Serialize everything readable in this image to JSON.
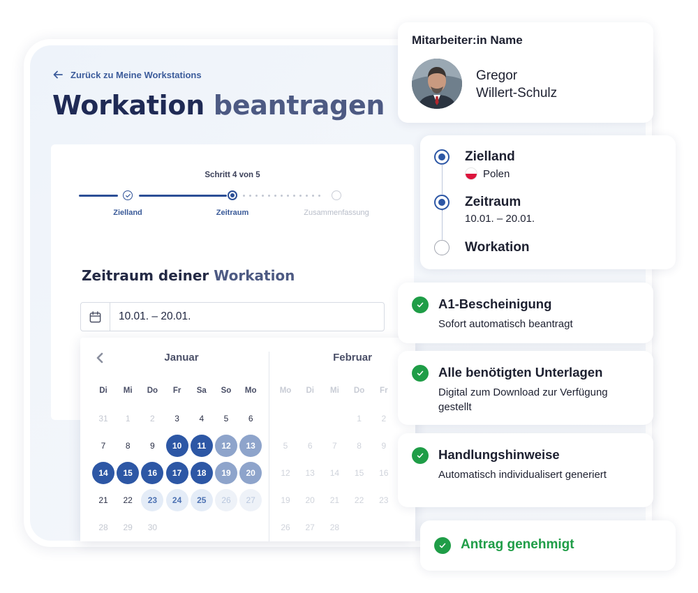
{
  "page": {
    "back_link": "Zurück zu Meine Workstations",
    "title_part1": "Workation",
    "title_part2": "beantragen"
  },
  "wizard": {
    "step_count": "Schritt 4 von 5",
    "steps": [
      {
        "label": "Zielland",
        "state": "done"
      },
      {
        "label": "Zeitraum",
        "state": "active"
      },
      {
        "label": "Zusammenfassung",
        "state": "pending"
      }
    ],
    "section_title_part1": "Zeitraum deiner",
    "section_title_part2": "Workation",
    "date_value": "10.01. – 20.01."
  },
  "calendar": {
    "months": [
      {
        "name": "Januar",
        "weekdays": [
          "Di",
          "Mi",
          "Do",
          "Fr",
          "Sa",
          "So",
          "Mo"
        ],
        "rows": [
          [
            "31",
            "1",
            "2",
            "3",
            "4",
            "5",
            "6"
          ],
          [
            "7",
            "8",
            "9",
            "10",
            "11",
            "12",
            "13"
          ],
          [
            "14",
            "15",
            "16",
            "17",
            "18",
            "19",
            "20"
          ],
          [
            "21",
            "22",
            "23",
            "24",
            "25",
            "26",
            "27"
          ],
          [
            "28",
            "29",
            "30",
            "",
            "",
            "",
            ""
          ]
        ]
      },
      {
        "name": "Februar",
        "weekdays": [
          "Mo",
          "Di",
          "Mi",
          "Do",
          "Fr"
        ],
        "rows": [
          [
            "",
            "",
            "",
            "1",
            "2"
          ],
          [
            "5",
            "6",
            "7",
            "8",
            "9"
          ],
          [
            "12",
            "13",
            "14",
            "15",
            "16"
          ],
          [
            "19",
            "20",
            "21",
            "22",
            "23"
          ],
          [
            "26",
            "27",
            "28",
            "",
            ""
          ]
        ]
      }
    ],
    "colors": {
      "selected": "#2d57a5",
      "selected_weekend": "#8ea4cb",
      "hover": "#e4ecf7"
    }
  },
  "employee": {
    "label": "Mitarbeiter:in Name",
    "first_name": "Gregor",
    "last_name": "Willert-Schulz"
  },
  "timeline": {
    "items": [
      {
        "title": "Zielland",
        "sub": "Polen",
        "state": "active"
      },
      {
        "title": "Zeitraum",
        "sub": "10.01. – 20.01.",
        "state": "active"
      },
      {
        "title": "Workation",
        "sub": "",
        "state": "empty"
      }
    ]
  },
  "features": [
    {
      "title": "A1-Bescheinigung",
      "text": "Sofort automatisch beantragt"
    },
    {
      "title": "Alle benötigten Unterlagen",
      "text": "Digital zum Download zur Verfügung gestellt"
    },
    {
      "title": "Handlungshinweise",
      "text": "Automatisch individualisert generiert"
    }
  ],
  "status": {
    "label": "Antrag genehmigt",
    "color": "#1f9d47"
  }
}
